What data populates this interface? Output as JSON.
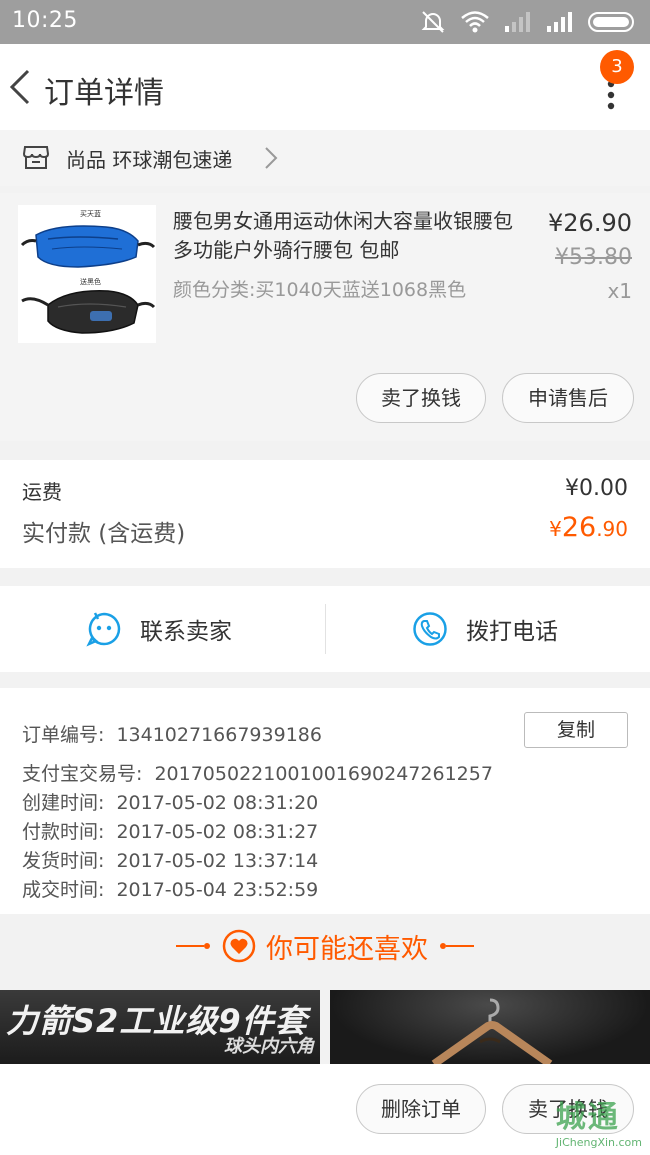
{
  "status_bar": {
    "time": "10:25"
  },
  "nav": {
    "title": "订单详情",
    "badge_count": "3"
  },
  "shop": {
    "name": "尚品 环球潮包速递"
  },
  "product": {
    "title": "腰包男女通用运动休闲大容量收银腰包多功能户外骑行腰包 包邮",
    "sku": "颜色分类:买1040天蓝送1068黑色",
    "price": "¥26.90",
    "original_price": "¥53.80",
    "quantity": "x1",
    "thumb_label_top": "买天蓝",
    "thumb_label_bottom": "送黑色"
  },
  "actions": {
    "sell_label": "卖了换钱",
    "after_sale_label": "申请售后"
  },
  "fees": {
    "shipping_label": "运费",
    "shipping_value": "¥0.00",
    "paid_label": "实付款 (含运费)",
    "paid_currency": "¥",
    "paid_int": "26",
    "paid_dec": ".90"
  },
  "contact": {
    "seller_label": "联系卖家",
    "phone_label": "拨打电话"
  },
  "order_info": {
    "order_no_label": "订单编号:",
    "order_no": "13410271667939186",
    "copy_label": "复制",
    "alipay_label": "支付宝交易号:",
    "alipay_no": "2017050221001001690247261257",
    "created_label": "创建时间:",
    "created": "2017-05-02 08:31:20",
    "paid_time_label": "付款时间:",
    "paid_time": "2017-05-02 08:31:27",
    "shipped_label": "发货时间:",
    "shipped": "2017-05-02 13:37:14",
    "completed_label": "成交时间:",
    "completed": "2017-05-04 23:52:59"
  },
  "recommend": {
    "title": "你可能还喜欢",
    "banner1_line1": "力箭S2工业级9件套",
    "banner1_line2": "球头内六角"
  },
  "bottom": {
    "delete_label": "删除订单",
    "sell_label": "卖了换钱"
  },
  "watermark": {
    "text": "城通",
    "url": "JiChengXin.com"
  },
  "colors": {
    "accent": "#ff5a00",
    "contact_blue": "#1aa0e6",
    "status_bar": "#9e9e9e"
  }
}
